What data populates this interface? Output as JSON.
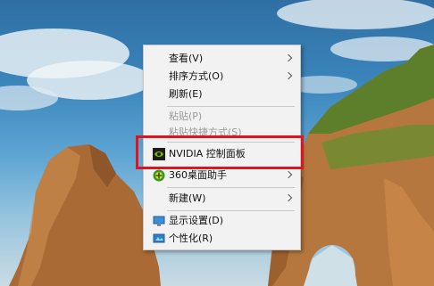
{
  "desktop": {
    "colors": {
      "sky": "#3b86bd",
      "rock": "#b8743c",
      "grass": "#5d7e2a"
    }
  },
  "context_menu": {
    "items": [
      {
        "label": "查看(V)",
        "icon": null,
        "submenu": true,
        "disabled": false
      },
      {
        "label": "排序方式(O)",
        "icon": null,
        "submenu": true,
        "disabled": false
      },
      {
        "label": "刷新(E)",
        "icon": null,
        "submenu": false,
        "disabled": false
      },
      {
        "label": "粘贴(P)",
        "icon": null,
        "submenu": false,
        "disabled": true
      },
      {
        "label": "粘贴快捷方式(S)",
        "icon": null,
        "submenu": false,
        "disabled": true
      },
      {
        "label": "NVIDIA 控制面板",
        "icon": "nvidia-icon",
        "submenu": false,
        "disabled": false
      },
      {
        "label": "360桌面助手",
        "icon": "360-assistant-icon",
        "submenu": true,
        "disabled": false
      },
      {
        "label": "新建(W)",
        "icon": null,
        "submenu": true,
        "disabled": false
      },
      {
        "label": "显示设置(D)",
        "icon": "display-settings-icon",
        "submenu": false,
        "disabled": false
      },
      {
        "label": "个性化(R)",
        "icon": "personalize-icon",
        "submenu": false,
        "disabled": false
      }
    ],
    "highlight_color": "#e0141c"
  }
}
